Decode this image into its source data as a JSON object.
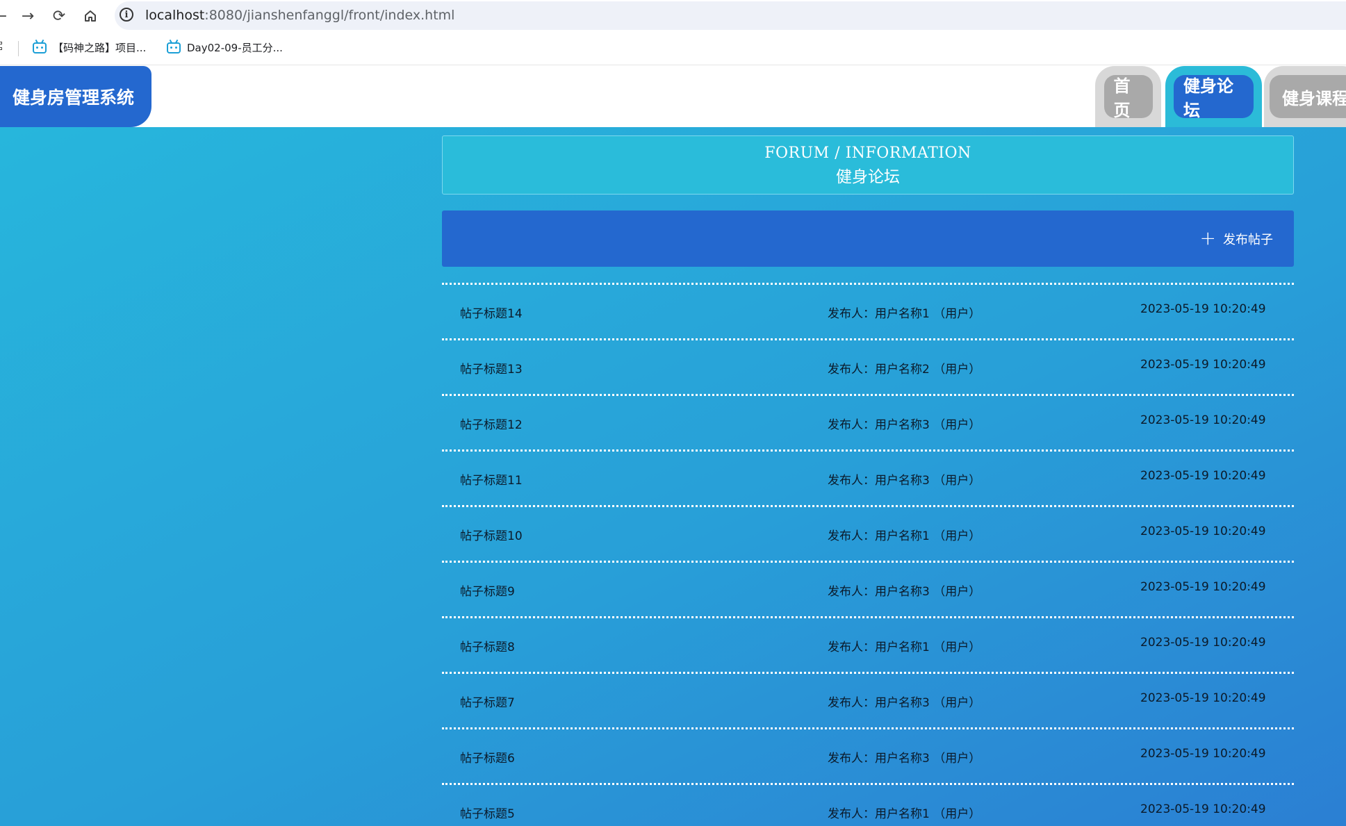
{
  "browser": {
    "url_host": "localhost",
    "url_path": ":8080/jianshenfanggl/front/index.html",
    "bookmarks": [
      {
        "label": "【码神之路】项目..."
      },
      {
        "label": "Day02-09-员工分..."
      }
    ]
  },
  "header": {
    "logo": "健身房管理系统",
    "nav": [
      {
        "label": "首页",
        "active": false
      },
      {
        "label": "健身论坛",
        "active": true
      },
      {
        "label": "健身课程",
        "active": false
      }
    ]
  },
  "forum": {
    "title_en": "FORUM / INFORMATION",
    "title_cn": "健身论坛",
    "publish_label": "发布帖子",
    "posts": [
      {
        "title": "帖子标题14",
        "author": "发布人：用户名称1 （用户）",
        "time": "2023-05-19 10:20:49"
      },
      {
        "title": "帖子标题13",
        "author": "发布人：用户名称2 （用户）",
        "time": "2023-05-19 10:20:49"
      },
      {
        "title": "帖子标题12",
        "author": "发布人：用户名称3 （用户）",
        "time": "2023-05-19 10:20:49"
      },
      {
        "title": "帖子标题11",
        "author": "发布人：用户名称3 （用户）",
        "time": "2023-05-19 10:20:49"
      },
      {
        "title": "帖子标题10",
        "author": "发布人：用户名称1 （用户）",
        "time": "2023-05-19 10:20:49"
      },
      {
        "title": "帖子标题9",
        "author": "发布人：用户名称3 （用户）",
        "time": "2023-05-19 10:20:49"
      },
      {
        "title": "帖子标题8",
        "author": "发布人：用户名称1 （用户）",
        "time": "2023-05-19 10:20:49"
      },
      {
        "title": "帖子标题7",
        "author": "发布人：用户名称3 （用户）",
        "time": "2023-05-19 10:20:49"
      },
      {
        "title": "帖子标题6",
        "author": "发布人：用户名称3 （用户）",
        "time": "2023-05-19 10:20:49"
      },
      {
        "title": "帖子标题5",
        "author": "发布人：用户名称1 （用户）",
        "time": "2023-05-19 10:20:49"
      }
    ]
  }
}
